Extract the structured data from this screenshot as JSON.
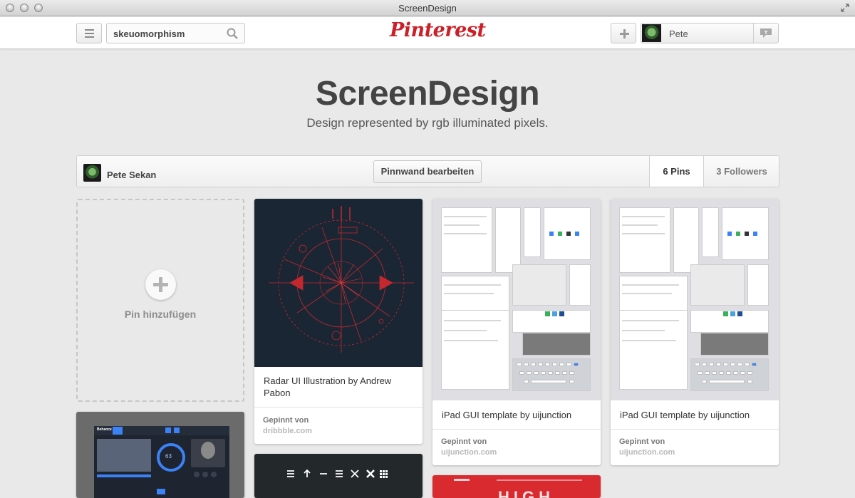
{
  "window": {
    "title": "ScreenDesign"
  },
  "header": {
    "search_value": "skeuomorphism",
    "logo_text": "Pinterest",
    "user_name": "Pete",
    "brand_color": "#cb2027"
  },
  "board": {
    "title": "ScreenDesign",
    "description": "Design represented by rgb illuminated pixels.",
    "owner_name": "Pete Sekan",
    "edit_button": "Pinnwand bearbeiten",
    "pins_count": "6 Pins",
    "followers_count": "3 Followers"
  },
  "add_pin": {
    "label": "Pin hinzufügen"
  },
  "pins": [
    {
      "description": "Radar UI Illustration by Andrew Pabon",
      "meta_label": "Gepinnt von",
      "source": "dribbble.com"
    },
    {
      "description": "iPad GUI template by uijunction",
      "meta_label": "Gepinnt von",
      "source": "uijunction.com"
    },
    {
      "description": "iPad GUI template by uijunction",
      "meta_label": "Gepinnt von",
      "source": "uijunction.com"
    }
  ],
  "partial_pins": {
    "behance_tab": "Behance",
    "gauge_value": "63",
    "red_pin_text": "HIGH"
  }
}
